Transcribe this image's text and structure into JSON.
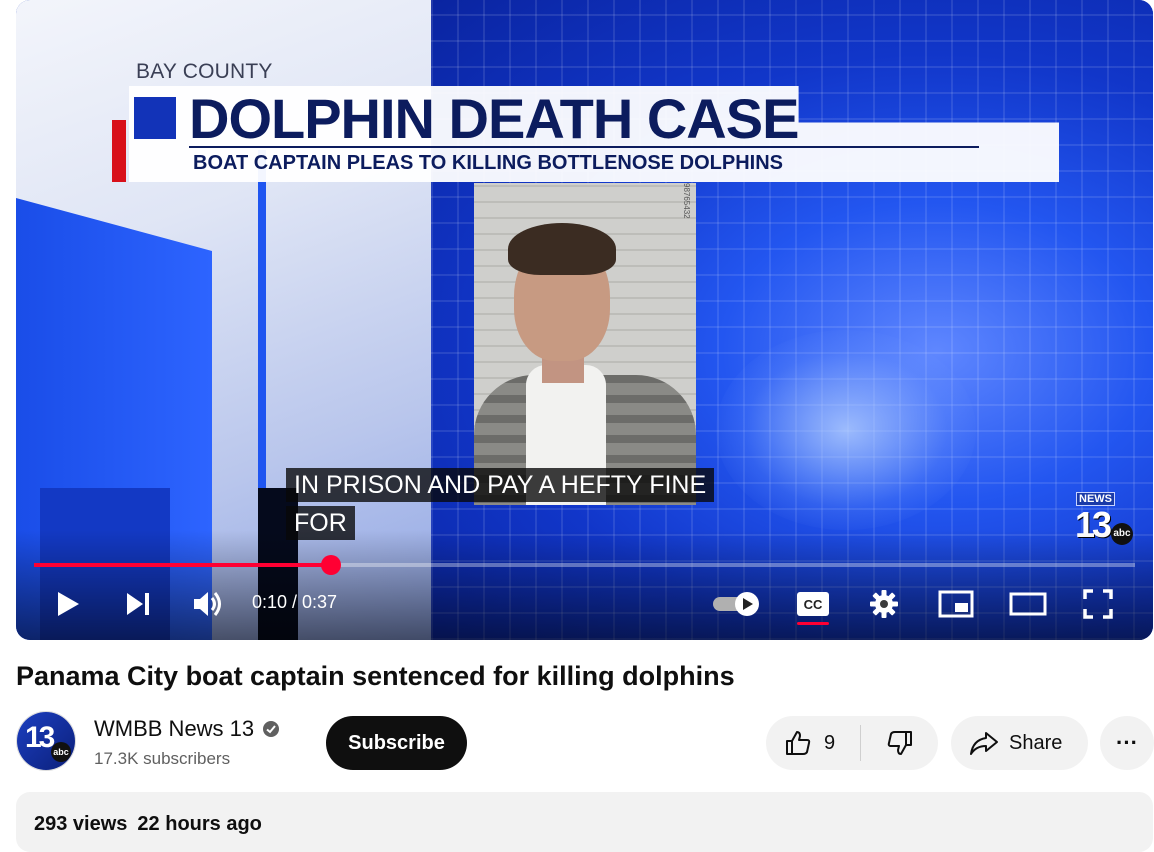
{
  "video": {
    "graphic": {
      "county": "BAY COUNTY",
      "headline": "DOLPHIN DEATH CASE",
      "subheadline": "BOAT CAPTAIN PLEAS TO KILLING BOTTLENOSE DOLPHINS"
    },
    "mug_ruler": "98765432",
    "captions": {
      "line1": "IN PRISON AND PAY A HEFTY FINE",
      "line2": "FOR"
    },
    "watermark": {
      "news": "NEWS",
      "number": "13",
      "network": "abc"
    },
    "controls": {
      "current_time": "0:10",
      "duration": "0:37",
      "time_display": "0:10 / 0:37",
      "progress_fraction": 0.27,
      "cc_label": "CC",
      "autoplay": "on",
      "captions_on": true
    },
    "icons": [
      "play-icon",
      "next-icon",
      "volume-icon",
      "autoplay-toggle-icon",
      "cc-icon",
      "settings-icon",
      "miniplayer-icon",
      "theater-icon",
      "fullscreen-icon"
    ]
  },
  "title": "Panama City boat captain sentenced for killing dolphins",
  "channel": {
    "name": "WMBB News 13",
    "subscribers": "17.3K subscribers",
    "verified": true,
    "avatar_number": "13",
    "avatar_network": "abc"
  },
  "actions": {
    "subscribe_label": "Subscribe",
    "like_count": "9",
    "share_label": "Share",
    "more_label": "···"
  },
  "description": {
    "views": "293 views",
    "posted": "22 hours ago"
  },
  "colors": {
    "accent_red": "#ff0033",
    "subscribe_bg": "#0f0f0f",
    "pill_bg": "#f2f2f2"
  }
}
